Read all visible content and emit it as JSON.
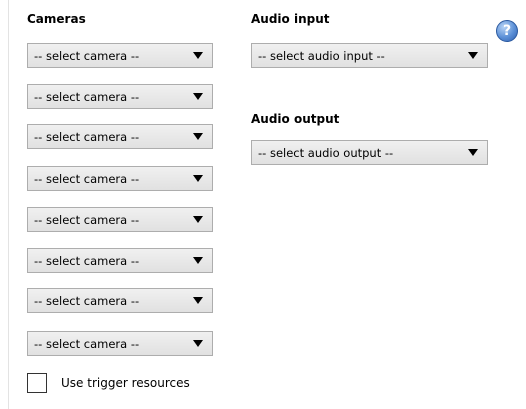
{
  "cameras": {
    "label": "Cameras",
    "selects": [
      "-- select camera --",
      "-- select camera --",
      "-- select camera --",
      "-- select camera --",
      "-- select camera --",
      "-- select camera --",
      "-- select camera --",
      "-- select camera --"
    ]
  },
  "audio_input": {
    "label": "Audio input",
    "value": "-- select audio input --"
  },
  "audio_output": {
    "label": "Audio output",
    "value": "-- select audio output --"
  },
  "trigger": {
    "label": "Use trigger resources",
    "checked": false
  },
  "help": {
    "glyph": "?",
    "icon": "help-icon",
    "color": "#4a7fcf"
  }
}
